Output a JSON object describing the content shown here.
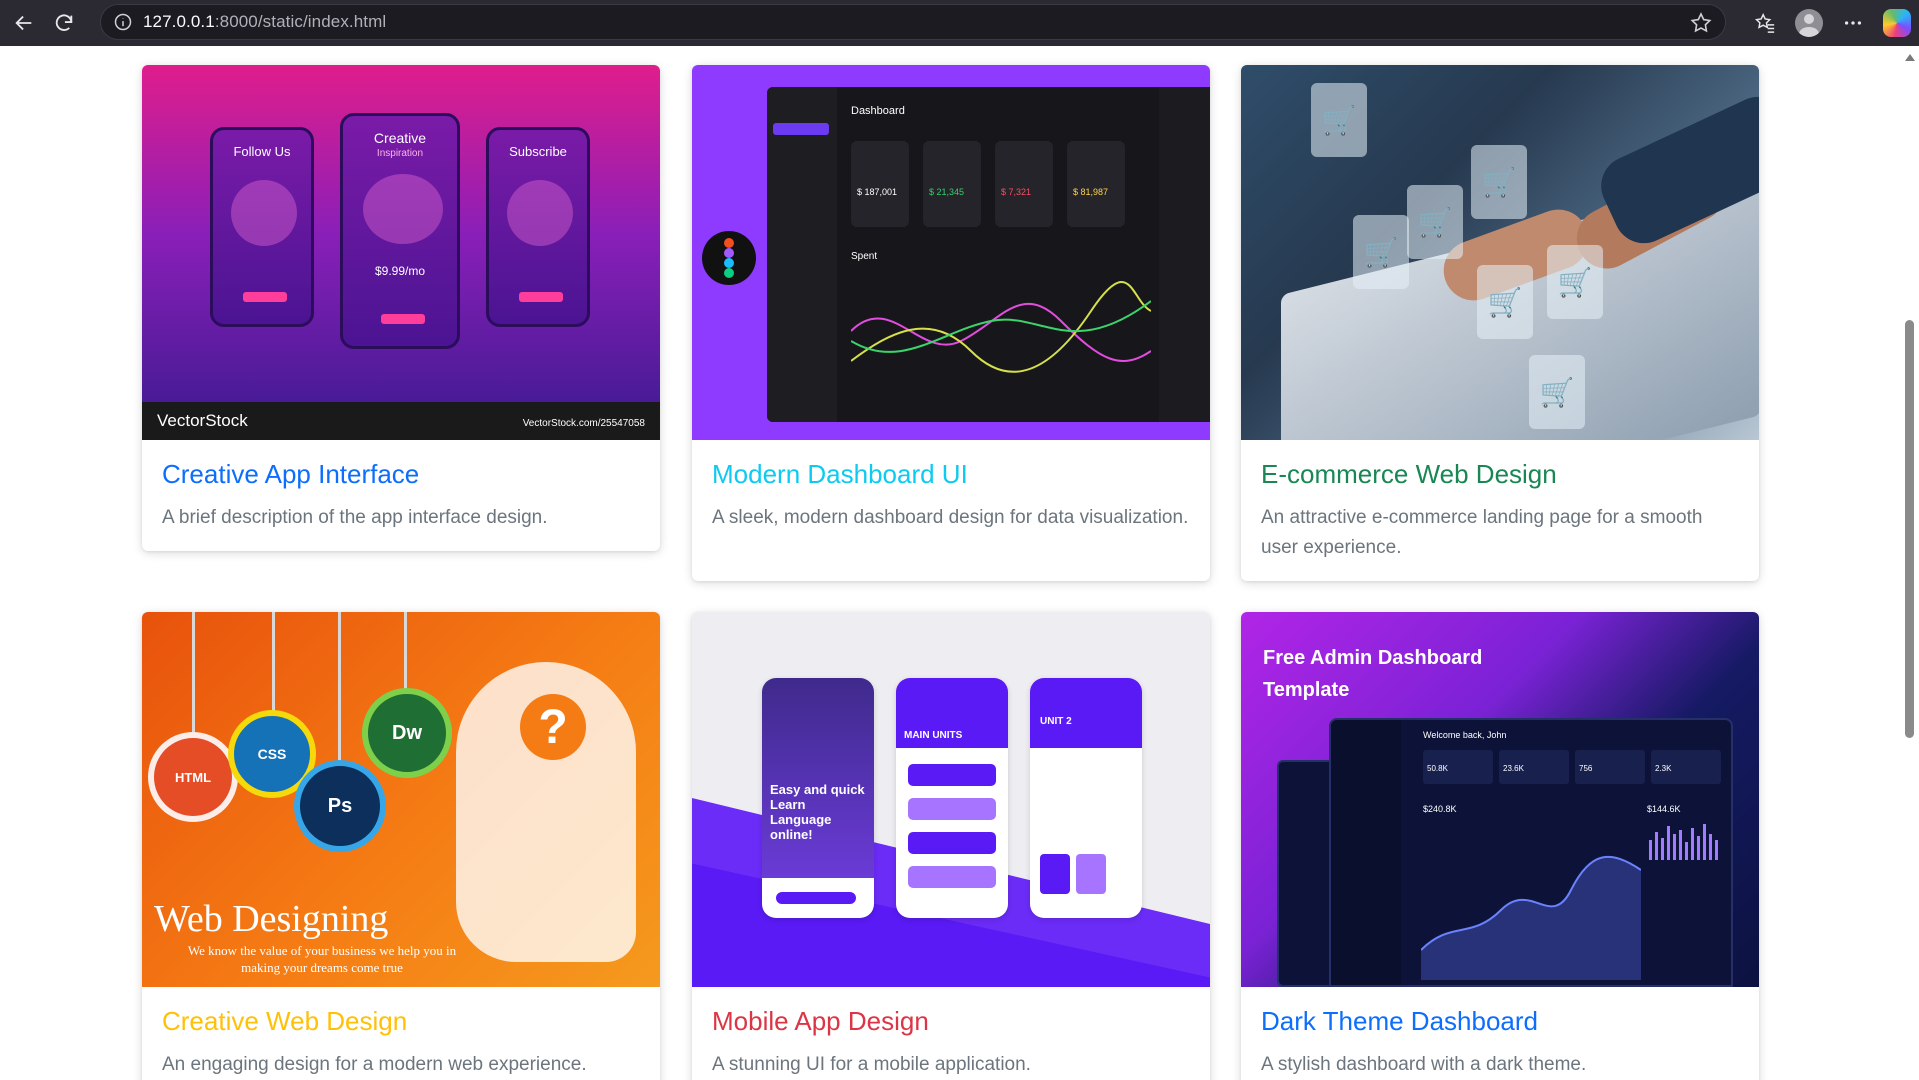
{
  "browser": {
    "url_host": "127.0.0.1",
    "url_rest": ":8000/static/index.html"
  },
  "cards": [
    {
      "title": "Creative App Interface",
      "description": "A brief description of the app interface design.",
      "title_color": "#0d6efd",
      "image": {
        "phone_left": "Follow Us",
        "phone_mid": "Creative",
        "phone_mid_sub": "Inspiration",
        "phone_right": "Subscribe",
        "price": "$9.99/mo",
        "watermark_left": "VectorStock",
        "watermark_right": "VectorStock.com/25547058"
      }
    },
    {
      "title": "Modern Dashboard UI",
      "description": "A sleek, modern dashboard design for data visualization.",
      "title_color": "#0dcaf0",
      "image": {
        "dashboard_title": "Dashboard",
        "tiles": [
          "$ 187,001",
          "$ 21,345",
          "$ 7,321",
          "$ 81,987"
        ],
        "spent": "Spent"
      }
    },
    {
      "title": "E-commerce Web Design",
      "description": "An attractive e-commerce landing page for a smooth user experience.",
      "title_color": "#198754"
    },
    {
      "title": "Creative Web Design",
      "description": "An engaging design for a modern web experience.",
      "title_color": "#ffc107",
      "image": {
        "badges": [
          "HTML",
          "CSS",
          "Ps",
          "Dw"
        ],
        "headline": "Web Designing",
        "subline": "We know the value of your business we help you in making your dreams come true"
      }
    },
    {
      "title": "Mobile App Design",
      "description": "A stunning UI for a mobile application.",
      "title_color": "#dc3545",
      "image": {
        "left_phone_text": "Easy and quick Learn Language online!",
        "mid_phone_title": "MAIN UNITS",
        "right_phone_title": "UNIT 2"
      }
    },
    {
      "title": "Dark Theme Dashboard",
      "description": "A stylish dashboard with a dark theme.",
      "title_color": "#0d6efd",
      "image": {
        "headline": "Free Admin Dashboard Template",
        "greeting": "Welcome back, John",
        "kpis": [
          "50.8K",
          "23.6K",
          "756",
          "2.3K"
        ],
        "revenue": "$240.8K",
        "side_value": "$144.6K"
      }
    }
  ]
}
